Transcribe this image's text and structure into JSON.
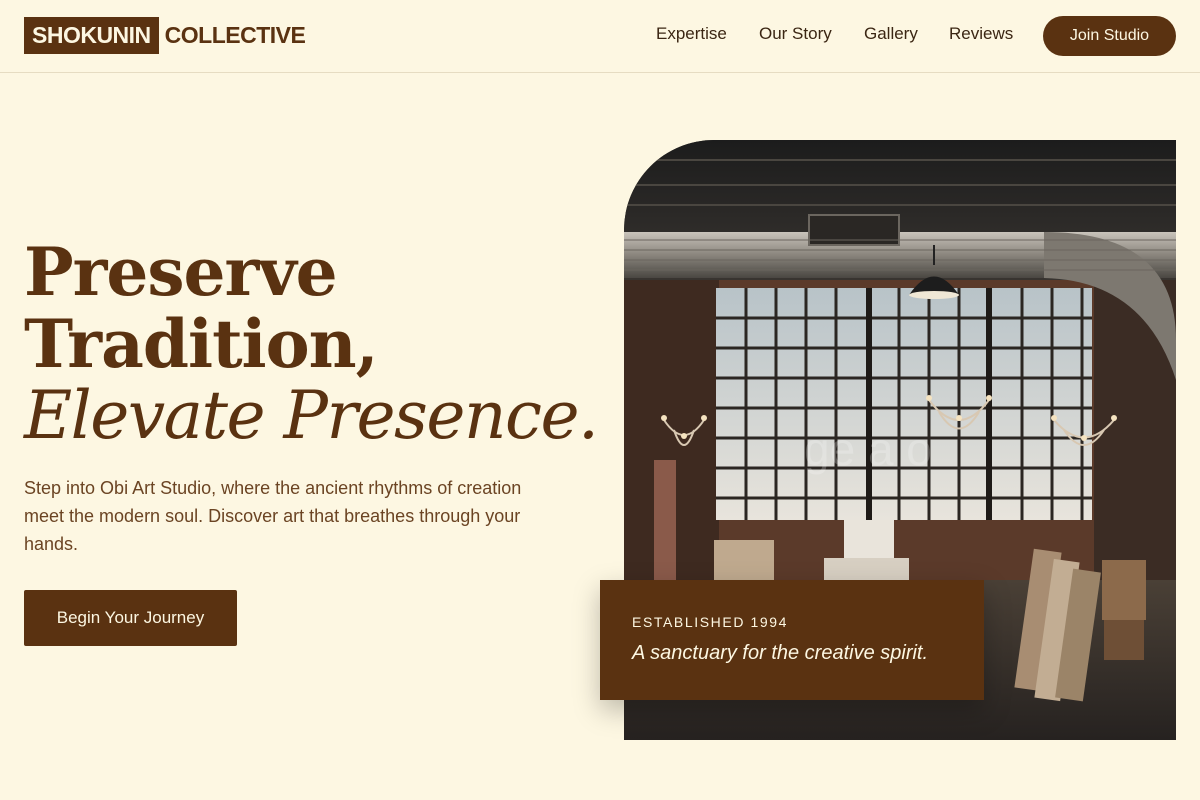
{
  "header": {
    "logo_box": "SHOKUNIN",
    "logo_rest": "COLLECTIVE",
    "nav": [
      {
        "label": "Expertise"
      },
      {
        "label": "Our Story"
      },
      {
        "label": "Gallery"
      },
      {
        "label": "Reviews"
      }
    ],
    "join_label": "Join Studio"
  },
  "hero": {
    "line1": "Preserve",
    "line2": "Tradition,",
    "line3": "Elevate Presence.",
    "subcopy": "Step into Obi Art Studio, where the ancient rhythms of creation meet the modern soul. Discover art that breathes through your hands.",
    "cta_label": "Begin Your Journey",
    "image_name": "studio-interior-photo",
    "caption_small": "ESTABLISHED 1994",
    "caption_italic": "A sanctuary for the creative spirit."
  },
  "colors": {
    "background": "#fdf7e2",
    "brand_brown": "#5a3211",
    "text_brown": "#6b4423"
  }
}
